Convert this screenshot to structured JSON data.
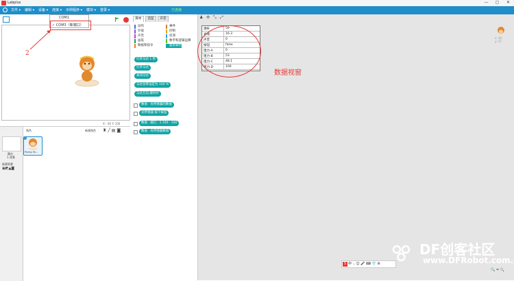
{
  "titlebar": {
    "title": "Labplus",
    "minimize": "—",
    "maximize": "▢",
    "close": "✕"
  },
  "menu": {
    "items": [
      "文件 ▾",
      "编辑 ▾",
      "设备 ▾",
      "连接 ▾",
      "示例程序 ▾",
      "模块 ▾",
      "登录 ▾"
    ],
    "center_note": "已连接"
  },
  "dropdown": {
    "option1": "COM1",
    "option2": "✓  COM3（新端口）"
  },
  "annotation": {
    "arrow_label": "2",
    "data_label": "数据视窗"
  },
  "stage": {
    "coords_x": "X: -36",
    "coords_y": "Y: 156"
  },
  "sprites": {
    "header": "角色",
    "new_sprite": "新建角色",
    "sprite_name": "Piying Sh...",
    "stage_label": "舞台",
    "stage_sub": "1 背景",
    "new_bg": "新建背景"
  },
  "palette": {
    "tabs": [
      "脚本",
      "造型",
      "声音"
    ],
    "categories": [
      {
        "label": "动作",
        "color": "#4a6cd4"
      },
      {
        "label": "外观",
        "color": "#8a55d7"
      },
      {
        "label": "声音",
        "color": "#bb42c3"
      },
      {
        "label": "画笔",
        "color": "#0e9a6c"
      },
      {
        "label": "数据和指令",
        "color": "#ee7d16"
      },
      {
        "label": "事件",
        "color": "#c88330"
      },
      {
        "label": "控制",
        "color": "#e1a91a"
      },
      {
        "label": "侦测",
        "color": "#2ca5e2"
      },
      {
        "label": "数字和逻辑运算",
        "color": "#5cb712"
      },
      {
        "label": "盛思掌控",
        "color": "#12a5a5"
      }
    ],
    "blocks": [
      "打开马达 1 秒",
      "打开马达",
      "关闭马达",
      "马达功率设定为 100 %",
      "马达方向 顺时针",
      "数值 · 光传感器的数值",
      "光传感器 按下按钮",
      "数值 · 端口 · 1 100 · 100",
      "数值 · 光传感器数值"
    ]
  },
  "toolbar": {
    "icons": [
      "person-icon",
      "expand-icon",
      "shrink-icon",
      "resize-icon"
    ]
  },
  "datawindow": {
    "rows": [
      {
        "k": "滑杆",
        "v": "59"
      },
      {
        "k": "光线",
        "v": "16.3"
      },
      {
        "k": "声音",
        "v": "0"
      },
      {
        "k": "按钮",
        "v": "false"
      },
      {
        "k": "阻力-A",
        "v": "0"
      },
      {
        "k": "阻力-B",
        "v": "53"
      },
      {
        "k": "阻力-C",
        "v": "48.1"
      },
      {
        "k": "阻力-D",
        "v": "100"
      }
    ]
  },
  "rightinfo": {
    "x": "x: 30",
    "y": "y: 17"
  },
  "zoom": {
    "label": "🔍 = 🔍"
  },
  "watermark": {
    "line1": "DF创客社区",
    "line2": "www.DFRobot.com.cn"
  },
  "ime": {
    "label": "中 ·, ☺ 🎤 ⌨ 👕 ⚙"
  }
}
